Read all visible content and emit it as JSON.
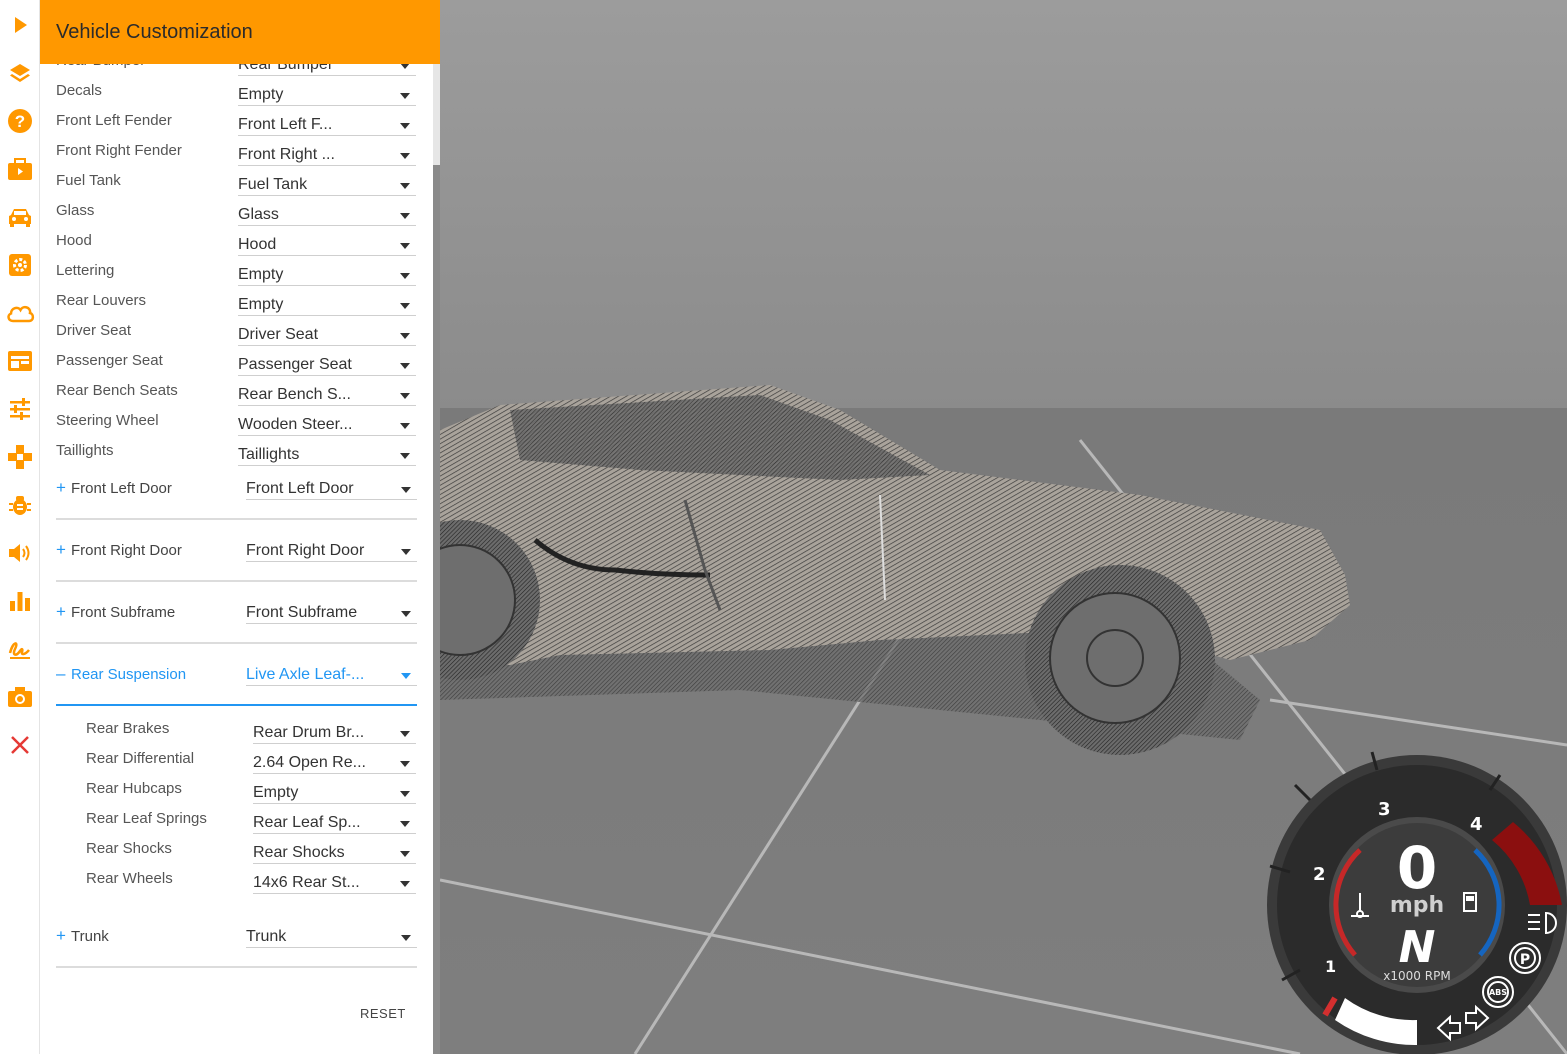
{
  "panel": {
    "title": "Vehicle Customization",
    "reset_label": "RESET"
  },
  "rail": {
    "icons": [
      "play-icon",
      "layers-icon",
      "help-icon",
      "toolbox-icon",
      "car-icon",
      "settings-icon",
      "cloud-icon",
      "dashboard-icon",
      "sliders-icon",
      "gamepad-icon",
      "bug-icon",
      "speaker-icon",
      "bar-chart-icon",
      "signature-icon",
      "camera-icon",
      "close-icon"
    ],
    "accent": "#ff9800",
    "close_color": "#e53935"
  },
  "parts": [
    {
      "label": "Rear Bumper",
      "value": "Rear Bumper"
    },
    {
      "label": "Decals",
      "value": "Empty"
    },
    {
      "label": "Front Left Fender",
      "value": "Front Left F..."
    },
    {
      "label": "Front Right Fender",
      "value": "Front Right ..."
    },
    {
      "label": "Fuel Tank",
      "value": "Fuel Tank"
    },
    {
      "label": "Glass",
      "value": "Glass"
    },
    {
      "label": "Hood",
      "value": "Hood"
    },
    {
      "label": "Lettering",
      "value": "Empty"
    },
    {
      "label": "Rear Louvers",
      "value": "Empty"
    },
    {
      "label": "Driver Seat",
      "value": "Driver Seat"
    },
    {
      "label": "Passenger Seat",
      "value": "Passenger Seat"
    },
    {
      "label": "Rear Bench Seats",
      "value": "Rear Bench S..."
    },
    {
      "label": "Steering Wheel",
      "value": "Wooden Steer..."
    },
    {
      "label": "Taillights",
      "value": "Taillights"
    }
  ],
  "groups": [
    {
      "sign": "+",
      "label": "Front Left Door",
      "value": "Front Left Door"
    },
    {
      "sign": "+",
      "label": "Front Right Door",
      "value": "Front Right Door"
    },
    {
      "sign": "+",
      "label": "Front Subframe",
      "value": "Front Subframe"
    },
    {
      "sign": "–",
      "label": "Rear Suspension",
      "value": "Live Axle Leaf-..."
    },
    {
      "sign": "+",
      "label": "Trunk",
      "value": "Trunk"
    }
  ],
  "sub_parts": [
    {
      "label": "Rear Brakes",
      "value": "Rear Drum Br..."
    },
    {
      "label": "Rear Differential",
      "value": "2.64 Open Re..."
    },
    {
      "label": "Rear Hubcaps",
      "value": "Empty"
    },
    {
      "label": "Rear Leaf Springs",
      "value": "Rear Leaf Sp..."
    },
    {
      "label": "Rear Shocks",
      "value": "Rear Shocks"
    },
    {
      "label": "Rear Wheels",
      "value": "14x6 Rear St..."
    }
  ],
  "gauge": {
    "speed": "0",
    "speed_unit": "mph",
    "gear": "N",
    "rpm_unit": "x1000 RPM",
    "tick_labels": [
      "1",
      "2",
      "3",
      "4"
    ],
    "abs_label": "ABS",
    "parking_label": "P"
  }
}
